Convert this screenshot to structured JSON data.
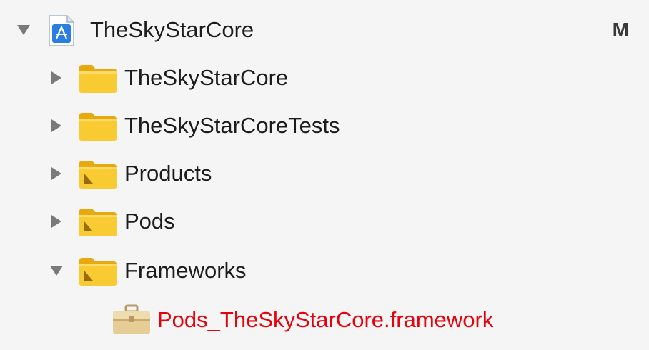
{
  "project": {
    "name": "TheSkyStarCore",
    "status_badge": "M",
    "expanded": true,
    "icon": "xcode-project-icon"
  },
  "items": [
    {
      "label": "TheSkyStarCore",
      "icon": "folder-icon",
      "expanded": false
    },
    {
      "label": "TheSkyStarCoreTests",
      "icon": "folder-icon",
      "expanded": false
    },
    {
      "label": "Products",
      "icon": "group-folder-icon",
      "expanded": false
    },
    {
      "label": "Pods",
      "icon": "group-folder-icon",
      "expanded": false
    },
    {
      "label": "Frameworks",
      "icon": "group-folder-icon",
      "expanded": true
    }
  ],
  "frameworks_children": [
    {
      "label": "Pods_TheSkyStarCore.framework",
      "icon": "framework-icon",
      "missing": true
    }
  ],
  "colors": {
    "missing_file": "#e8000b",
    "folder": "#f7c531",
    "text": "#1c1c1c"
  }
}
